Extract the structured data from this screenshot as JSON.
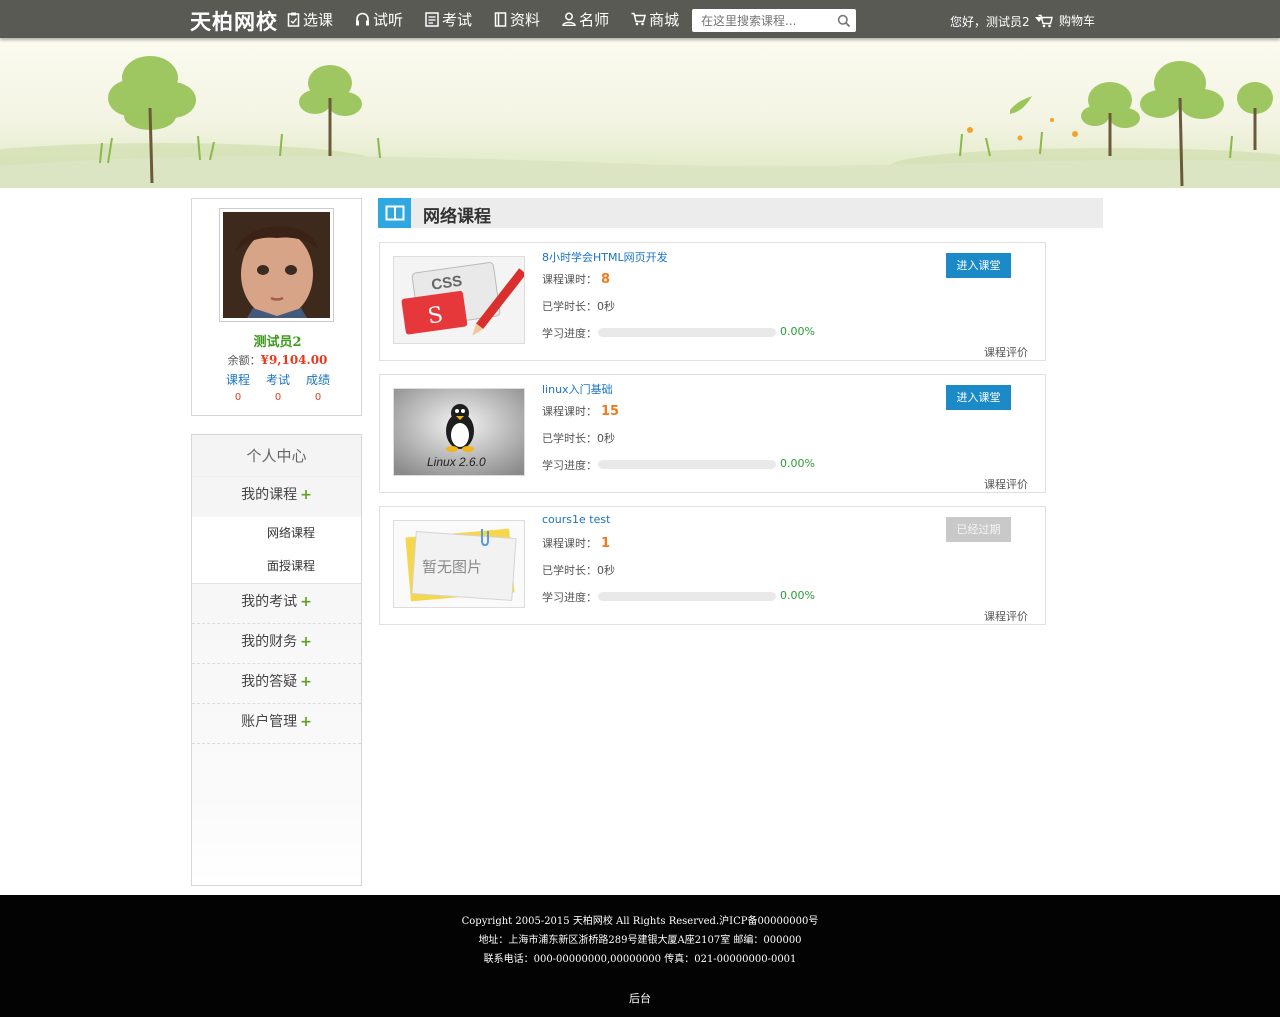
{
  "header": {
    "logo": "天柏网校",
    "nav": [
      {
        "label": "选课",
        "icon": "clipboard-icon"
      },
      {
        "label": "试听",
        "icon": "headphones-icon"
      },
      {
        "label": "考试",
        "icon": "document-icon"
      },
      {
        "label": "资料",
        "icon": "book-icon"
      },
      {
        "label": "名师",
        "icon": "user-icon"
      },
      {
        "label": "商城",
        "icon": "cart-icon"
      }
    ],
    "search_placeholder": "在这里搜索课程...",
    "greeting": "您好，测试员2",
    "cart_label": "购物车"
  },
  "profile": {
    "name": "测试员2",
    "balance_label": "余额：",
    "balance_value": "¥9,104.00",
    "stats": [
      {
        "label": "课程",
        "value": "0"
      },
      {
        "label": "考试",
        "value": "0"
      },
      {
        "label": "成绩",
        "value": "0"
      }
    ]
  },
  "menu": {
    "title": "个人中心",
    "groups": [
      {
        "label": "我的课程",
        "plus": "+"
      },
      {
        "label": "我的考试",
        "plus": "+"
      },
      {
        "label": "我的财务",
        "plus": "+"
      },
      {
        "label": "我的答疑",
        "plus": "+"
      },
      {
        "label": "账户管理",
        "plus": "+"
      }
    ],
    "subitems": [
      "网络课程",
      "面授课程"
    ]
  },
  "main": {
    "section_title": "网络课程",
    "labels": {
      "hours": "课程课时：",
      "studied": "已学时长：",
      "progress": "学习进度：",
      "review": "课程评价"
    },
    "courses": [
      {
        "title": "8小时学会HTML网页开发",
        "hours": "8",
        "studied": "0秒",
        "progress": 0,
        "progress_text": "0.00%",
        "button": "进入课堂",
        "thumb": "CSS"
      },
      {
        "title": "linux入门基础",
        "hours": "15",
        "studied": "0秒",
        "progress": 0,
        "progress_text": "0.00%",
        "button": "进入课堂",
        "thumb": "Linux 2.6.0"
      },
      {
        "title": "cours1e test",
        "hours": "1",
        "studied": "0秒",
        "progress": 0,
        "progress_text": "0.00%",
        "button": "已经过期",
        "thumb": "暂无图片"
      }
    ]
  },
  "footer": {
    "copyright": "Copyright 2005-2015 天柏网校 All Rights Reserved.沪ICP备00000000号",
    "address": "地址：上海市浦东新区浙桥路289号建银大厦A座2107室 邮编：000000",
    "phone": "联系电话：000-00000000,00000000 传真：021-00000000-0001",
    "admin": "后台"
  },
  "colors": {
    "nav_bg": "#5a5a55",
    "accent_blue": "#1b8ac7",
    "section_icon": "#2fa8e0",
    "name_green": "#3b9a1c",
    "price_red": "#e8391c",
    "hours_orange": "#ef7b1f",
    "percent_green": "#2a9d34"
  }
}
